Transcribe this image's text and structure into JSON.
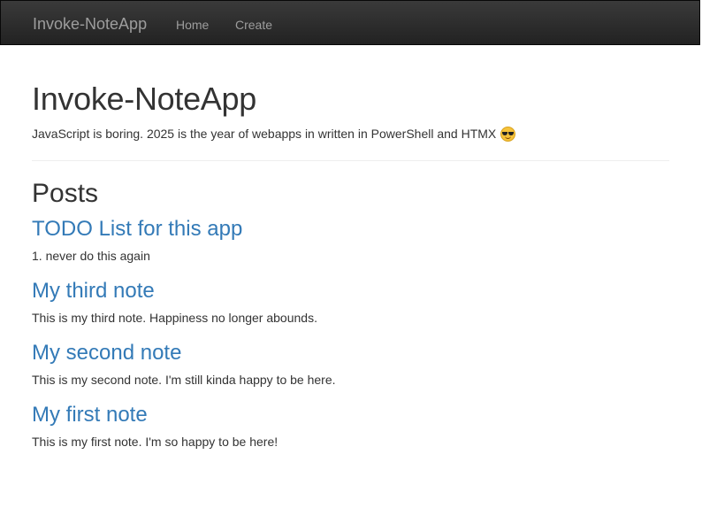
{
  "navbar": {
    "brand": "Invoke-NoteApp",
    "links": [
      "Home",
      "Create"
    ]
  },
  "header": {
    "title": "Invoke-NoteApp",
    "tagline": "JavaScript is boring. 2025 is the year of webapps in written in PowerShell and HTMX",
    "tagline_icon": "smiling-face-with-sunglasses-icon"
  },
  "posts": {
    "heading": "Posts",
    "items": [
      {
        "title": "TODO List for this app",
        "body": "1. never do this again"
      },
      {
        "title": "My third note",
        "body": "This is my third note. Happiness no longer abounds."
      },
      {
        "title": "My second note",
        "body": "This is my second note. I'm still kinda happy to be here."
      },
      {
        "title": "My first note",
        "body": "This is my first note. I'm so happy to be here!"
      }
    ]
  },
  "colors": {
    "navbar_bg": "#222222",
    "nav_text": "#9d9d9d",
    "link": "#337ab7",
    "text": "#333333"
  }
}
